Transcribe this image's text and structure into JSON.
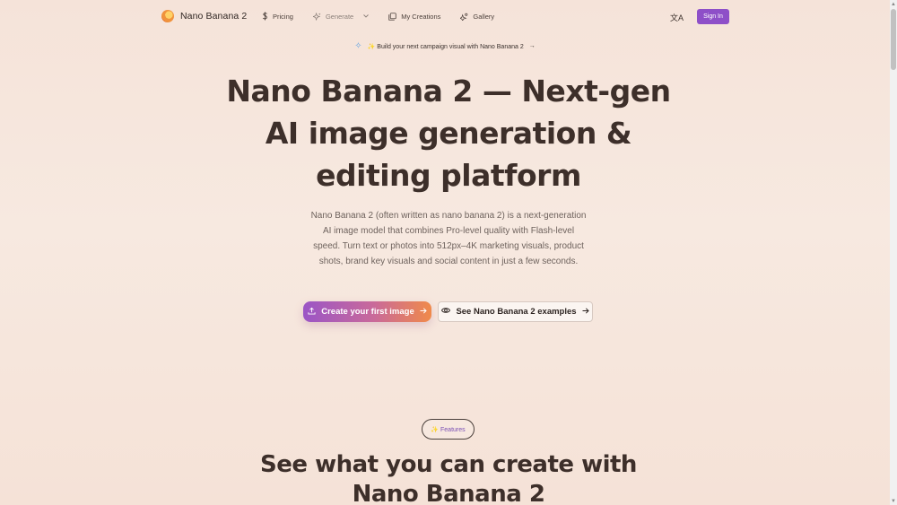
{
  "nav": {
    "brand": "Nano Banana 2",
    "pricing": "Pricing",
    "generate": "Generate",
    "my_creations": "My Creations",
    "gallery": "Gallery",
    "translate_glyph": "文A",
    "sign_in": "Sign In"
  },
  "announcement": {
    "text": "✨ Build your next campaign visual with Nano Banana 2",
    "arrow": "→"
  },
  "hero": {
    "title_line1": "Nano Banana 2 — Next-gen",
    "title_line2": "AI image generation &",
    "title_line3": "editing platform",
    "description": "Nano Banana 2 (often written as nano banana 2) is a next-generation AI image model that combines Pro-level quality with Flash-level speed. Turn text or photos into 512px–4K marketing visuals, product shots, brand key visuals and social content in just a few seconds.",
    "primary_button": "Create your first image",
    "secondary_button": "See Nano Banana 2 examples"
  },
  "features": {
    "pill": "✨ Features",
    "title_line1": "See what you can create with",
    "title_line2": "Nano Banana 2"
  },
  "colors": {
    "accent": "#8e4fc8",
    "gradient_start": "#9b55c6",
    "gradient_end": "#f08a4a",
    "background": "#f6e4da"
  }
}
